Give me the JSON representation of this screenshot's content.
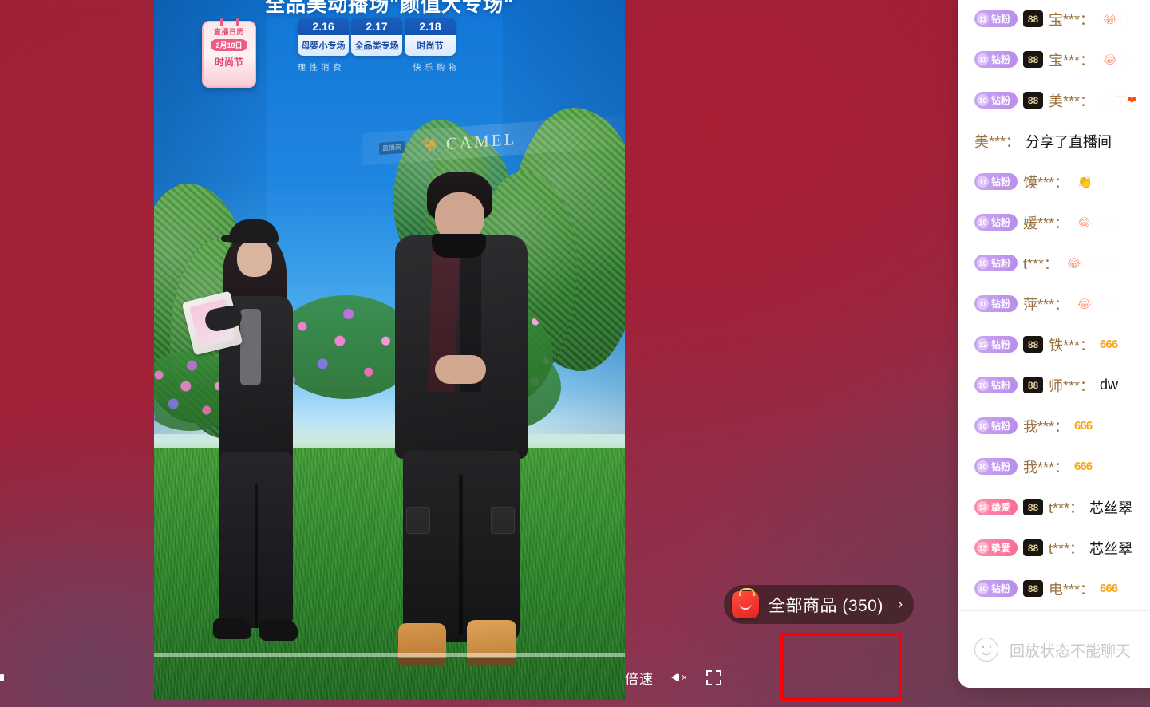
{
  "page": {
    "background_accent": "#9e2038",
    "annotation_color": "#fe0000"
  },
  "video": {
    "headline": "全品美动播场\"颜值大专场\"",
    "brand": {
      "chip": "直播间",
      "name": "CAMEL",
      "camel_glyph": "🐪"
    },
    "calendar": {
      "title": "直播日历",
      "date": "2月18日",
      "label": "时尚节"
    },
    "schedule": [
      {
        "date": "2.16",
        "name": "母婴小专场"
      },
      {
        "date": "2.17",
        "name": "全品类专场"
      },
      {
        "date": "2.18",
        "name": "时尚节"
      }
    ],
    "slogan_left": "理 性 消 费",
    "slogan_right": "快 乐 购 物",
    "product_pill": {
      "icon": "shopping-bag-icon",
      "label": "全部商品 (350)",
      "chevron": "›"
    },
    "controls": {
      "speed_label": "倍速",
      "volume_icon": "volume-muted-icon",
      "fullscreen_icon": "fullscreen-icon"
    },
    "seek": {
      "progress_percent": 100
    }
  },
  "chat": {
    "messages": [
      {
        "badge": {
          "kind": "diamond",
          "level": "11",
          "text": "钻粉"
        },
        "vip": "88",
        "user": "宝***",
        "colon": "：",
        "text": "😂哈",
        "style": "emoji"
      },
      {
        "badge": {
          "kind": "diamond",
          "level": "11",
          "text": "钻粉"
        },
        "vip": "88",
        "user": "宝***",
        "colon": "：",
        "text": "😂哈",
        "style": "emoji"
      },
      {
        "badge": {
          "kind": "diamond",
          "level": "10",
          "text": "钻粉"
        },
        "vip": "88",
        "user": "美***",
        "colon": "：",
        "text": "爱了❤",
        "style": "sticker"
      },
      {
        "badge": null,
        "vip": null,
        "user": "美***",
        "colon": "：",
        "text": "分享了直播间",
        "style": "plain"
      },
      {
        "badge": {
          "kind": "diamond",
          "level": "11",
          "text": "钻粉"
        },
        "vip": null,
        "user": "馍***",
        "colon": "：",
        "text": "👏",
        "style": "emoji"
      },
      {
        "badge": {
          "kind": "diamond",
          "level": "10",
          "text": "钻粉"
        },
        "vip": null,
        "user": "媛***",
        "colon": "：",
        "text": "😂哈哈",
        "style": "emoji"
      },
      {
        "badge": {
          "kind": "diamond",
          "level": "10",
          "text": "钻粉"
        },
        "vip": null,
        "user": "t***",
        "colon": "：",
        "text": "😂哈哈哈",
        "style": "emoji"
      },
      {
        "badge": {
          "kind": "diamond",
          "level": "11",
          "text": "钻粉"
        },
        "vip": null,
        "user": "萍***",
        "colon": "：",
        "text": "😂哈哈",
        "style": "emoji"
      },
      {
        "badge": {
          "kind": "diamond",
          "level": "12",
          "text": "钻粉"
        },
        "vip": "88",
        "user": "铁***",
        "colon": "：",
        "text": "666",
        "style": "s666"
      },
      {
        "badge": {
          "kind": "diamond",
          "level": "10",
          "text": "钻粉"
        },
        "vip": "88",
        "user": "师***",
        "colon": "：",
        "text": "dw",
        "style": "plain-text"
      },
      {
        "badge": {
          "kind": "diamond",
          "level": "10",
          "text": "钻粉"
        },
        "vip": null,
        "user": "我***",
        "colon": "：",
        "text": "666",
        "style": "s666"
      },
      {
        "badge": {
          "kind": "diamond",
          "level": "10",
          "text": "钻粉"
        },
        "vip": null,
        "user": "我***",
        "colon": "：",
        "text": "666",
        "style": "s666"
      },
      {
        "badge": {
          "kind": "love",
          "level": "13",
          "text": "挚爱"
        },
        "vip": "88",
        "user": "t***",
        "colon": "：",
        "text": "芯丝翠",
        "style": "plain-text"
      },
      {
        "badge": {
          "kind": "love",
          "level": "13",
          "text": "挚爱"
        },
        "vip": "88",
        "user": "t***",
        "colon": "：",
        "text": "芯丝翠",
        "style": "plain-text"
      },
      {
        "badge": {
          "kind": "diamond",
          "level": "10",
          "text": "钻粉"
        },
        "vip": "88",
        "user": "电***",
        "colon": "：",
        "text": "666",
        "style": "s666"
      }
    ],
    "input": {
      "emoji_icon": "smiley-icon",
      "placeholder": "回放状态不能聊天"
    }
  }
}
